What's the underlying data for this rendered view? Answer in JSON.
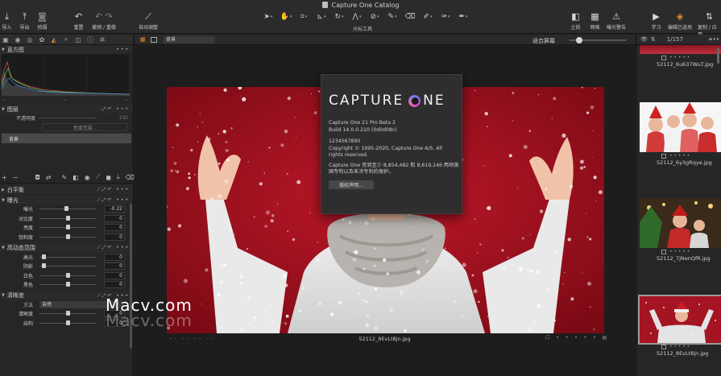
{
  "window": {
    "title": "Capture One Catalog"
  },
  "toolbar": {
    "import": "导入",
    "export": "导出",
    "capture": "拍摄",
    "reset": "重置",
    "undo_redo": "撤销 / 重做",
    "auto_adjust": "自动调整",
    "cursor_tools": "光标工具",
    "before": "之前",
    "grid": "网格",
    "exposure_warning": "曝光警告",
    "learn": "学习",
    "edit_selected": "编辑已选项",
    "copy_apply": "复制 / 应用"
  },
  "left_panel": {
    "histogram": {
      "title": "直方图",
      "foot_left": "--",
      "foot_mid": "--",
      "foot_right": "--"
    },
    "layers": {
      "title": "图层",
      "opacity_label": "不透明度",
      "opacity_value": "100",
      "brightness_btn": "亮度范围...",
      "items": [
        "背景"
      ]
    },
    "white_balance": {
      "title": "白平衡"
    },
    "exposure": {
      "title": "曝光",
      "rows": [
        {
          "label": "曝光",
          "value": "-0.22",
          "knob": 0.47
        },
        {
          "label": "对比度",
          "value": "0",
          "knob": 0.5
        },
        {
          "label": "亮度",
          "value": "0",
          "knob": 0.5
        },
        {
          "label": "饱和度",
          "value": "0",
          "knob": 0.5
        }
      ]
    },
    "hdr": {
      "title": "高动态范围",
      "rows": [
        {
          "label": "高光",
          "value": "0",
          "knob": 0.05
        },
        {
          "label": "阴影",
          "value": "0",
          "knob": 0.05
        },
        {
          "label": "白色",
          "value": "0",
          "knob": 0.5
        },
        {
          "label": "黑色",
          "value": "0",
          "knob": 0.5
        }
      ]
    },
    "clarity": {
      "title": "清晰度",
      "method_label": "方法",
      "method_value": "自然",
      "rows": [
        {
          "label": "清晰度",
          "value": "0",
          "knob": 0.5
        },
        {
          "label": "结构",
          "value": "0",
          "knob": 0.5
        }
      ]
    }
  },
  "viewer": {
    "variant_select": "背景",
    "fit_label": "适合屏幕",
    "dashes": "-- -- -- --",
    "caption": "52112_8EvLt8jn.jpg",
    "stars": "• • • • •"
  },
  "about": {
    "logo_left": "CAPTURE",
    "logo_right": "NE",
    "version": "Capture One 21 Pro  Beta 2",
    "build": "Build 14.0.0.210 (0d0d08c)",
    "serial": "1234567890",
    "copyright1": "Copyright © 1995-2020, Capture One A/S. All",
    "copyright2": "rights reserved.",
    "patent1": "Capture One 受到至少 8,854,482 和 8,619,146 两项美",
    "patent2": "国专利以及未决专利的保护。",
    "button": "版权声明..."
  },
  "watermark": {
    "text": "Macv.com"
  },
  "browser": {
    "count": "1/157",
    "stars": "• • • • •",
    "thumbnails": [
      {
        "name": "52112_6u637WuT.jpg"
      },
      {
        "name": "52112_6y3gRqye.jpg"
      },
      {
        "name": "52112_7jNenQfR.jpg"
      },
      {
        "name": "52112_8EvLt8jn.jpg"
      }
    ]
  }
}
